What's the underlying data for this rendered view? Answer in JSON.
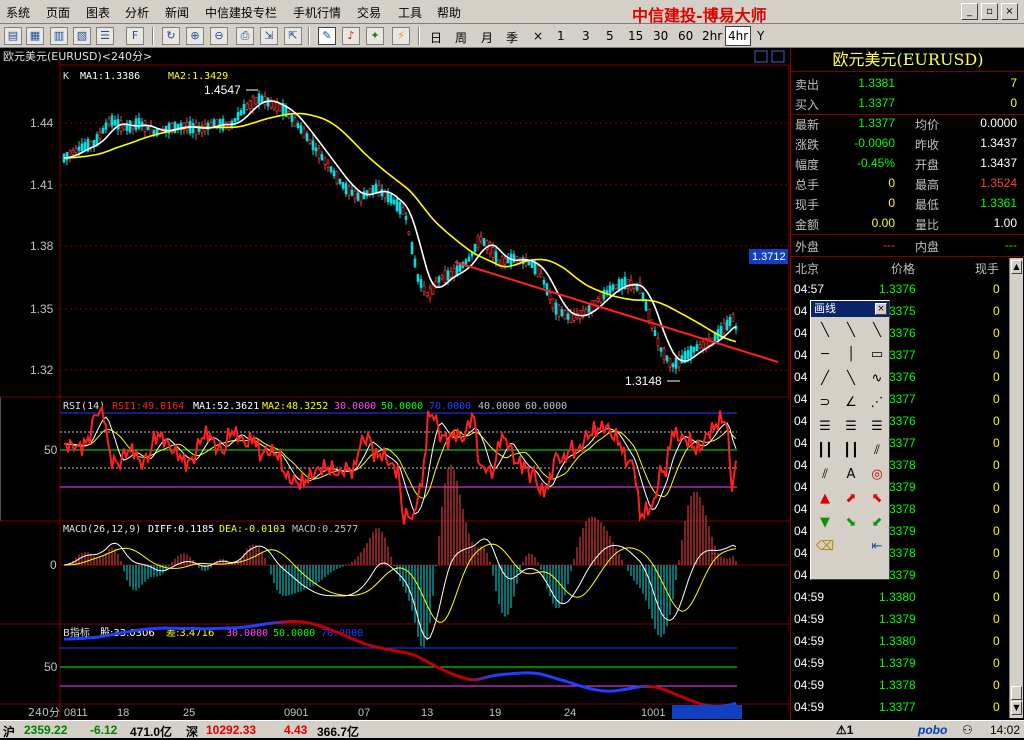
{
  "menu": {
    "items": [
      "系统",
      "页面",
      "图表",
      "分析",
      "新闻",
      "中信建投专栏",
      "手机行情",
      "交易",
      "工具",
      "帮助"
    ],
    "brand": "中信建投-博易大师"
  },
  "window_buttons": [
    "_",
    "▫",
    "×"
  ],
  "toolbar": {
    "periods": [
      "日",
      "周",
      "月",
      "季",
      "×",
      "1",
      "3",
      "5",
      "15",
      "30",
      "60",
      "2hr",
      "4hr",
      "Y"
    ],
    "active_period": "4hr"
  },
  "chart": {
    "header": "欧元美元(EURUSD)<240分>",
    "price_legend": {
      "k": "K",
      "ma1": "MA1:1.3386",
      "ma2": "MA2:1.3429"
    },
    "price_ticks": [
      "1.44",
      "1.41",
      "1.38",
      "1.35",
      "1.32"
    ],
    "high_label": "1.4547",
    "low_label": "1.3148",
    "current_price_tag": "1.3712",
    "rsi_legend": {
      "name": "RSI(14)",
      "rsi1": "RSI1:49.8164",
      "ma1": "MA1:52.3621",
      "ma2": "MA2:48.3252",
      "l30": "30.0000",
      "l50": "50.0000",
      "l70": "70.0000",
      "l40": "40.0000",
      "l60": "60.0000"
    },
    "rsi_tick": "50",
    "macd_legend": {
      "name": "MACD(26,12,9)",
      "diff": "DIFF:0.1185",
      "dea": "DEA:-0.0103",
      "macd": "MACD:0.2577"
    },
    "macd_tick": "0",
    "b_legend": {
      "name": "B指标",
      "gu": "股:33.0306",
      "cha": "差:3.4716",
      "l30": "30.0000",
      "l50": "50.0000",
      "l70": "70.0000"
    },
    "b_tick": "50",
    "x_axis": {
      "period_label": "240分",
      "labels": [
        "0811",
        "18",
        "25",
        "0901",
        "07",
        "13",
        "19",
        "24",
        "1001",
        "10-04 05:00"
      ]
    }
  },
  "quote": {
    "title": "欧元美元(EURUSD)",
    "sell": {
      "label": "卖出",
      "value": "1.3381",
      "vol": "7"
    },
    "buy": {
      "label": "买入",
      "value": "1.3377",
      "vol": "0"
    },
    "rows": [
      {
        "l1": "最新",
        "v1": "1.3377",
        "l2": "均价",
        "v2": "0.0000"
      },
      {
        "l1": "涨跌",
        "v1": "-0.0060",
        "l2": "昨收",
        "v2": "1.3437"
      },
      {
        "l1": "幅度",
        "v1": "-0.45%",
        "l2": "开盘",
        "v2": "1.3437"
      },
      {
        "l1": "总手",
        "v1": "0",
        "l2": "最高",
        "v2": "1.3524"
      },
      {
        "l1": "现手",
        "v1": "0",
        "l2": "最低",
        "v2": "1.3361"
      },
      {
        "l1": "金额",
        "v1": "0.00",
        "l2": "量比",
        "v2": "1.00"
      }
    ],
    "outer": {
      "label": "外盘",
      "value": "---"
    },
    "inner": {
      "label": "内盘",
      "value": "---"
    },
    "tick_headers": [
      "北京",
      "价格",
      "现手"
    ],
    "ticks": [
      {
        "time": "04:57",
        "price": "1.3376",
        "vol": "0"
      },
      {
        "time": "04",
        "price": "1.3375",
        "vol": "0"
      },
      {
        "time": "04",
        "price": "1.3376",
        "vol": "0"
      },
      {
        "time": "04",
        "price": "1.3377",
        "vol": "0"
      },
      {
        "time": "04",
        "price": "1.3376",
        "vol": "0"
      },
      {
        "time": "04",
        "price": "1.3377",
        "vol": "0"
      },
      {
        "time": "04",
        "price": "1.3376",
        "vol": "0"
      },
      {
        "time": "04",
        "price": "1.3377",
        "vol": "0"
      },
      {
        "time": "04",
        "price": "1.3378",
        "vol": "0"
      },
      {
        "time": "04",
        "price": "1.3379",
        "vol": "0"
      },
      {
        "time": "04",
        "price": "1.3378",
        "vol": "0"
      },
      {
        "time": "04",
        "price": "1.3379",
        "vol": "0"
      },
      {
        "time": "04",
        "price": "1.3378",
        "vol": "0"
      },
      {
        "time": "04",
        "price": "1.3379",
        "vol": "0"
      },
      {
        "time": "04:59",
        "price": "1.3380",
        "vol": "0"
      },
      {
        "time": "04:59",
        "price": "1.3379",
        "vol": "0"
      },
      {
        "time": "04:59",
        "price": "1.3380",
        "vol": "0"
      },
      {
        "time": "04:59",
        "price": "1.3379",
        "vol": "0"
      },
      {
        "time": "04:59",
        "price": "1.3378",
        "vol": "0"
      },
      {
        "time": "04:59",
        "price": "1.3377",
        "vol": "0"
      }
    ]
  },
  "palette": {
    "title": "画线",
    "close": "×"
  },
  "status": {
    "sh_label": "沪",
    "sh_index": "2359.22",
    "sh_change": "-6.12",
    "sh_amount": "471.0亿",
    "sz_label": "深",
    "sz_index": "10292.33",
    "sz_change": "4.43",
    "sz_amount": "366.7亿",
    "alert": "⚠1",
    "logo": "pobo",
    "clock": "14:02"
  },
  "colors": {
    "ma1": "#ffffff",
    "ma2": "#ffff00",
    "trend": "#ff2020",
    "up": "#ff4040",
    "down": "#00e0e0",
    "rsi": "#ff2020",
    "grid": "#800000",
    "label": "#c0c0c0",
    "green": "#00ff00"
  }
}
